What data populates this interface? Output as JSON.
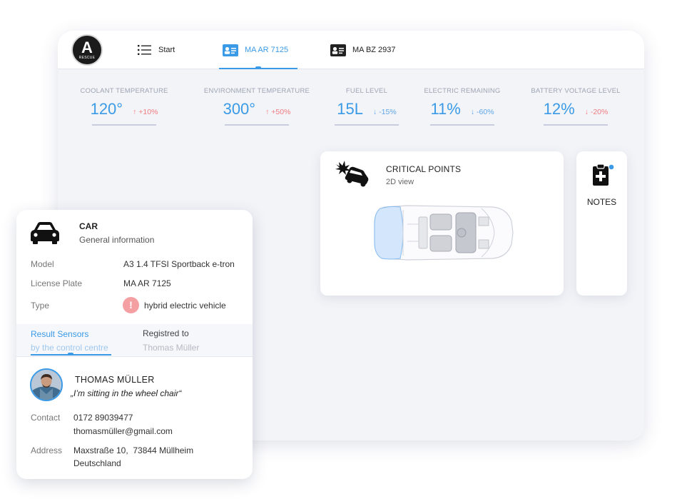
{
  "app": {
    "logo_letter": "A",
    "logo_text": "RESCUE"
  },
  "tabs": [
    {
      "label": "Start",
      "icon": "list-icon"
    },
    {
      "label": "MA AR 7125",
      "icon": "id-card-icon",
      "active": true
    },
    {
      "label": "MA BZ 2937",
      "icon": "id-card-icon"
    }
  ],
  "metrics": [
    {
      "label": "COOLANT TEMPERATURE",
      "value": "120°",
      "change": "+10%",
      "direction": "up"
    },
    {
      "label": "ENVIRONMENT TEMPERATURE",
      "value": "300°",
      "change": "+50%",
      "direction": "up"
    },
    {
      "label": "FUEL LEVEL",
      "value": "15L",
      "change": "-15%",
      "direction": "down"
    },
    {
      "label": "ELECTRIC REMAINING",
      "value": "11%",
      "change": "-60%",
      "direction": "down"
    },
    {
      "label": "BATTERY VOLTAGE LEVEL",
      "value": "12%",
      "change": "-20%",
      "direction": "down-alert"
    }
  ],
  "critical": {
    "title": "CRITICAL POINTS",
    "subtitle": "2D view",
    "icon": "car-crash-icon"
  },
  "notes": {
    "label": "NOTES",
    "icon": "medical-clipboard-icon"
  },
  "car_card": {
    "title": "CAR",
    "subtitle": "General information",
    "icon": "car-icon",
    "fields": [
      {
        "key": "Model",
        "value": "A3 1.4 TFSI Sportback e-tron"
      },
      {
        "key": "License Plate",
        "value": "MA AR 7125"
      },
      {
        "key": "Type",
        "value": "hybrid electric vehicle"
      }
    ],
    "type_alert_icon": "!",
    "subtabs": [
      {
        "title": "Result Sensors",
        "sub": "by the control centre",
        "active": true
      },
      {
        "title": "Registred to",
        "sub": "Thomas Müller"
      }
    ],
    "person": {
      "name": "THOMAS MÜLLER",
      "quote": "„I’m sitting in the wheel chair“",
      "contact_label": "Contact",
      "phone": "0172 89039477",
      "email": "thomasmüller@gmail.com",
      "address_label": "Address",
      "address_line1": "Maxstraße 10,  73844 Müllheim",
      "address_line2": "Deutschland"
    }
  },
  "colors": {
    "accent": "#3a9ae6",
    "alert": "#f07a80",
    "background": "#f3f4f8"
  }
}
